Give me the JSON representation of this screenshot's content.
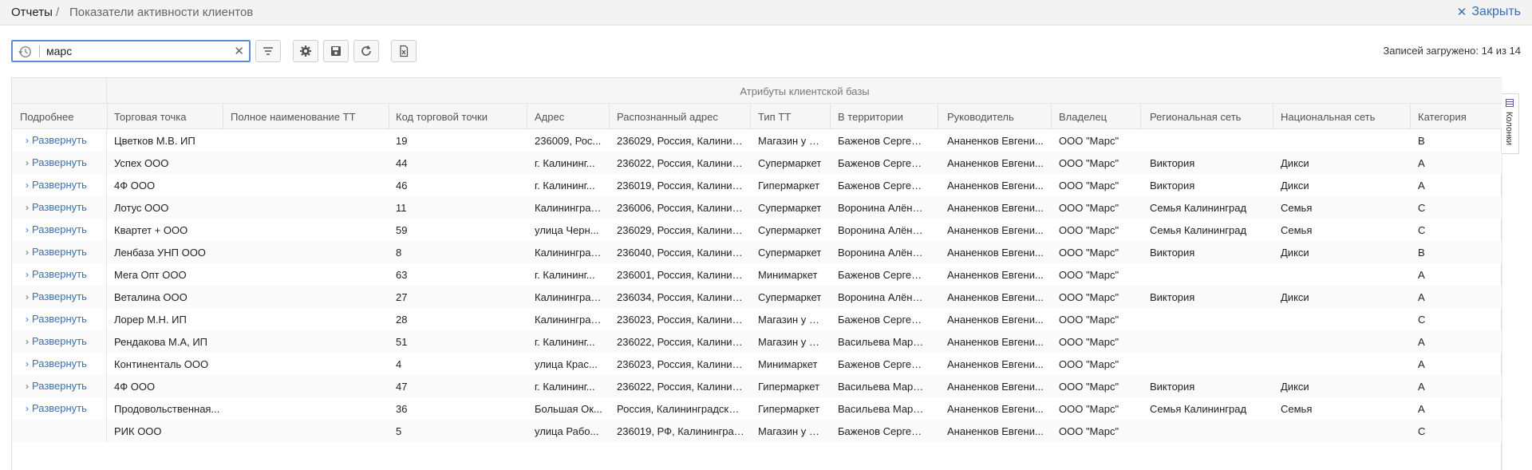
{
  "breadcrumb": {
    "root": "Отчеты",
    "separator": "/",
    "current": "Показатели активности клиентов"
  },
  "header": {
    "close_label": "Закрыть"
  },
  "search": {
    "value": "марс"
  },
  "records_text": "Записей загружено: 14 из 14",
  "grid": {
    "group_title": "Атрибуты клиентской базы",
    "columns": [
      "Подробнее",
      "Торговая точка",
      "Полное наименование ТТ",
      "Код торговой точки",
      "Адрес",
      "Распознанный адрес",
      "Тип ТТ",
      "В территории",
      "Руководитель",
      "Владелец",
      "Региональная сеть",
      "Национальная сеть",
      "Категория"
    ],
    "expand_label": "Развернуть",
    "rows": [
      {
        "expand": true,
        "tt": "Цветков М.В. ИП",
        "full": "",
        "code": "19",
        "addr": "236009, Рос...",
        "raddr": "236029, Россия, Калининг...",
        "type": "Магазин у д...",
        "terr": "Баженов Сергей В...",
        "head": "Ананенков Евгени...",
        "owner": "ООО \"Марс\"",
        "reg": "",
        "nat": "",
        "cat": "B"
      },
      {
        "expand": true,
        "tt": "Успех ООО",
        "full": "",
        "code": "44",
        "addr": "г. Калининг...",
        "raddr": "236022, Россия, Калининг...",
        "type": "Супермаркет",
        "terr": "Баженов Сергей В...",
        "head": "Ананенков Евгени...",
        "owner": "ООО \"Марс\"",
        "reg": "Виктория",
        "nat": "Дикси",
        "cat": "A"
      },
      {
        "expand": true,
        "tt": "4Ф ООО",
        "full": "",
        "code": "46",
        "addr": "г. Калининг...",
        "raddr": "236019, Россия, Калининг...",
        "type": "Гипермаркет",
        "terr": "Баженов Сергей В...",
        "head": "Ананенков Евгени...",
        "owner": "ООО \"Марс\"",
        "reg": "Виктория",
        "nat": "Дикси",
        "cat": "A"
      },
      {
        "expand": true,
        "tt": "Лотус ООО",
        "full": "",
        "code": "11",
        "addr": "Калининград...",
        "raddr": "236006, Россия, Калининг...",
        "type": "Супермаркет",
        "terr": "Воронина Алёна П...",
        "head": "Ананенков Евгени...",
        "owner": "ООО \"Марс\"",
        "reg": "Семья Калининград",
        "nat": "Семья",
        "cat": "C"
      },
      {
        "expand": true,
        "tt": "Квартет + ООО",
        "full": "",
        "code": "59",
        "addr": "улица Черн...",
        "raddr": "236029, Россия, Калининг...",
        "type": "Супермаркет",
        "terr": "Воронина Алёна П...",
        "head": "Ананенков Евгени...",
        "owner": "ООО \"Марс\"",
        "reg": "Семья Калининград",
        "nat": "Семья",
        "cat": "C"
      },
      {
        "expand": true,
        "tt": "Ленбаза УНП ООО",
        "full": "",
        "code": "8",
        "addr": "Калининград...",
        "raddr": "236040, Россия, Калининг...",
        "type": "Супермаркет",
        "terr": "Воронина Алёна П...",
        "head": "Ананенков Евгени...",
        "owner": "ООО \"Марс\"",
        "reg": "Виктория",
        "nat": "Дикси",
        "cat": "B"
      },
      {
        "expand": true,
        "tt": "Мега Опт ООО",
        "full": "",
        "code": "63",
        "addr": "г. Калининг...",
        "raddr": "236001, Россия, Калининг...",
        "type": "Минимаркет",
        "terr": "Баженов Сергей В...",
        "head": "Ананенков Евгени...",
        "owner": "ООО \"Марс\"",
        "reg": "",
        "nat": "",
        "cat": "A"
      },
      {
        "expand": true,
        "tt": "Веталина ООО",
        "full": "",
        "code": "27",
        "addr": "Калининград...",
        "raddr": "236034, Россия, Калининг...",
        "type": "Супермаркет",
        "terr": "Воронина Алёна П...",
        "head": "Ананенков Евгени...",
        "owner": "ООО \"Марс\"",
        "reg": "Виктория",
        "nat": "Дикси",
        "cat": "A"
      },
      {
        "expand": true,
        "tt": "Лорер М.Н. ИП",
        "full": "",
        "code": "28",
        "addr": "Калининград...",
        "raddr": "236023, Россия, Калининг...",
        "type": "Магазин у д...",
        "terr": "Баженов Сергей В...",
        "head": "Ананенков Евгени...",
        "owner": "ООО \"Марс\"",
        "reg": "",
        "nat": "",
        "cat": "C"
      },
      {
        "expand": true,
        "tt": "Рендакова М.А, ИП",
        "full": "",
        "code": "51",
        "addr": "г. Калининг...",
        "raddr": "236022, Россия, Калининг...",
        "type": "Магазин у д...",
        "terr": "Васильева Мария ...",
        "head": "Ананенков Евгени...",
        "owner": "ООО \"Марс\"",
        "reg": "",
        "nat": "",
        "cat": "A"
      },
      {
        "expand": true,
        "tt": "Континенталь ООО",
        "full": "",
        "code": "4",
        "addr": "улица Крас...",
        "raddr": "236023, Россия, Калининг...",
        "type": "Минимаркет",
        "terr": "Баженов Сергей В...",
        "head": "Ананенков Евгени...",
        "owner": "ООО \"Марс\"",
        "reg": "",
        "nat": "",
        "cat": "A"
      },
      {
        "expand": true,
        "tt": "4Ф ООО",
        "full": "",
        "code": "47",
        "addr": "г. Калининг...",
        "raddr": "236022, Россия, Калининг...",
        "type": "Гипермаркет",
        "terr": "Васильева Мария ...",
        "head": "Ананенков Евгени...",
        "owner": "ООО \"Марс\"",
        "reg": "Виктория",
        "nat": "Дикси",
        "cat": "A"
      },
      {
        "expand": true,
        "tt": "Продовольственная...",
        "full": "",
        "code": "36",
        "addr": "Большая Ок...",
        "raddr": "Россия, Калининградская ...",
        "type": "Гипермаркет",
        "terr": "Васильева Мария ...",
        "head": "Ананенков Евгени...",
        "owner": "ООО \"Марс\"",
        "reg": "Семья Калининград",
        "nat": "Семья",
        "cat": "A"
      },
      {
        "expand": false,
        "tt": "РИК ООО",
        "full": "",
        "code": "5",
        "addr": "улица Рабо...",
        "raddr": "236019, РФ, Калининградс...",
        "type": "Магазин у д...",
        "terr": "Баженов Сергей В...",
        "head": "Ананенков Евгени...",
        "owner": "ООО \"Марс\"",
        "reg": "",
        "nat": "",
        "cat": "C"
      }
    ]
  },
  "side_panel": {
    "label": "Колонки"
  },
  "colors": {
    "accent": "#3b6fb0",
    "search_border": "#5b8ed6"
  }
}
